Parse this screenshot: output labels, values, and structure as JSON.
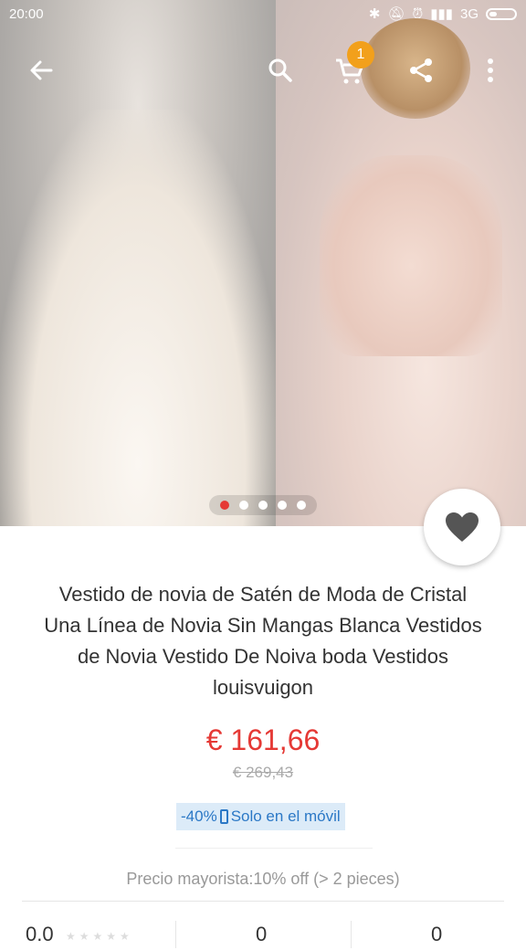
{
  "status_bar": {
    "time": "20:00",
    "network": "3G"
  },
  "header": {
    "cart_count": "1"
  },
  "gallery": {
    "image_count": 5,
    "active_index": 0
  },
  "product": {
    "title_lines": [
      "Vestido de novia de Satén de Moda de Cristal",
      "Una Línea de Novia Sin Mangas Blanca Vestidos",
      "de Novia Vestido De Noiva boda Vestidos",
      "louisvuigon"
    ],
    "price": "€ 161,66",
    "original_price": "€ 269,43",
    "discount": "-40%",
    "mobile_only": "Solo en el móvil",
    "wholesale": "Precio mayorista:10% off (> 2 pieces)"
  },
  "stats": {
    "rating": "0.0",
    "middle": "0",
    "right": "0"
  },
  "colors": {
    "accent": "#e53935",
    "badge": "#f2a01b",
    "promo_text": "#2b78c6",
    "promo_bg": "#dcebf8"
  }
}
